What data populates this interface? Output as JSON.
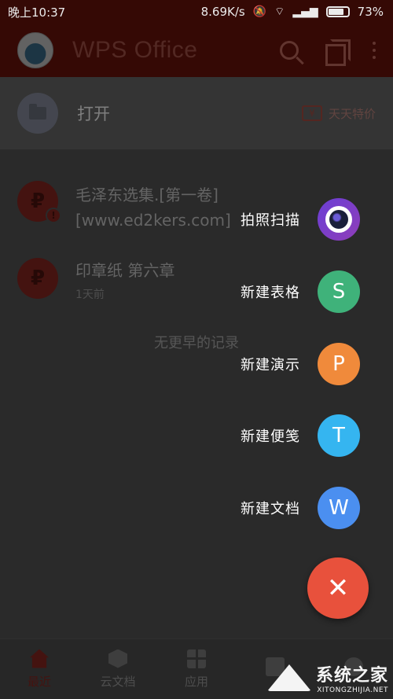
{
  "status_bar": {
    "time": "晚上10:37",
    "speed": "8.69K/s",
    "battery": "73%"
  },
  "app_bar": {
    "title": "WPS Office"
  },
  "open_row": {
    "label": "打开",
    "deal_label": "天天特价",
    "deal_icon": "¥"
  },
  "recent": {
    "files": [
      {
        "name_line1": "毛泽东选集.[第一卷]",
        "name_line2": "[www.ed2kers.com]",
        "time": ""
      },
      {
        "name_line1": "印章纸 第六章",
        "name_line2": "",
        "time": "1天前"
      }
    ],
    "end_text": "无更早的记录"
  },
  "fab_menu": {
    "items": [
      {
        "label": "拍照扫描",
        "icon": "camera-icon",
        "color": "#6a3fd6"
      },
      {
        "label": "新建表格",
        "icon": "S",
        "color": "#3fb27a"
      },
      {
        "label": "新建演示",
        "icon": "P",
        "color": "#f08a3b"
      },
      {
        "label": "新建便笺",
        "icon": "T",
        "color": "#35b5f0"
      },
      {
        "label": "新建文档",
        "icon": "W",
        "color": "#4b8ff0"
      }
    ],
    "close_icon": "✕",
    "close_color": "#e8513c"
  },
  "bottom_nav": {
    "items": [
      {
        "label": "最近",
        "active": true
      },
      {
        "label": "云文档",
        "active": false
      },
      {
        "label": "应用",
        "active": false
      },
      {
        "label": "",
        "active": false
      },
      {
        "label": "",
        "active": false
      }
    ]
  },
  "watermark": {
    "title": "系统之家",
    "subtitle": "XITONGZHIJIA.NET"
  }
}
